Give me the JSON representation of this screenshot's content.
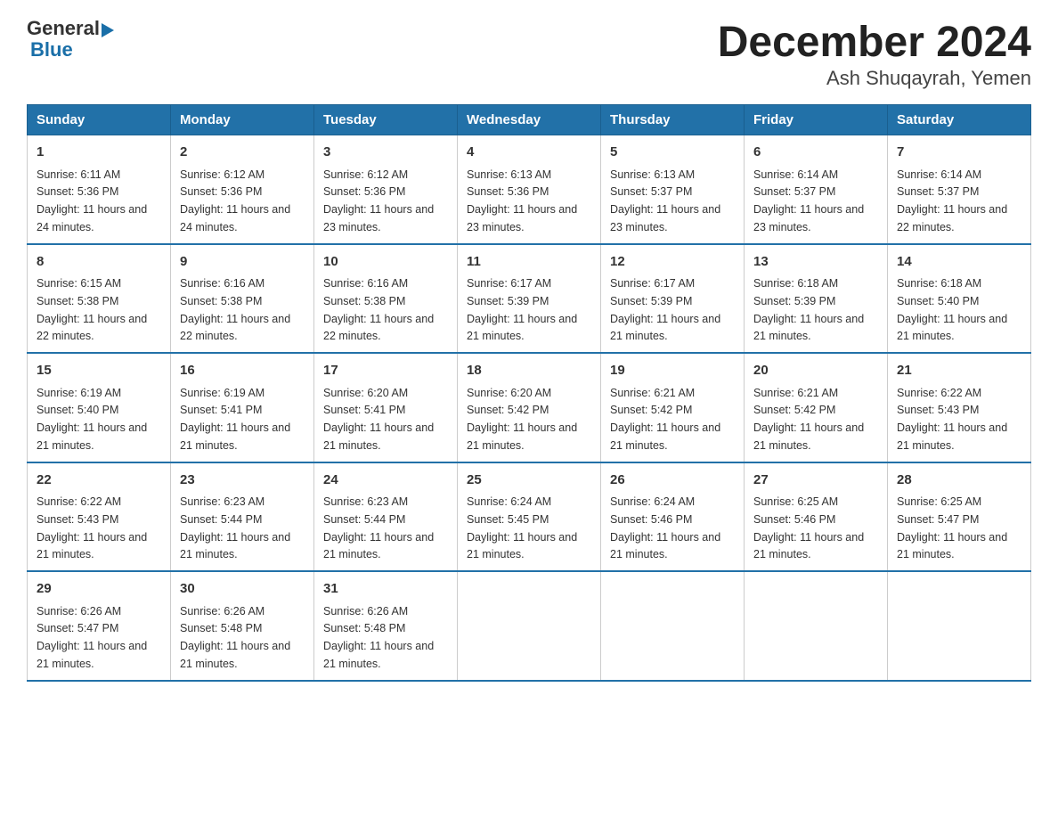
{
  "logo": {
    "general": "General",
    "blue": "Blue"
  },
  "title": "December 2024",
  "subtitle": "Ash Shuqayrah, Yemen",
  "days_of_week": [
    "Sunday",
    "Monday",
    "Tuesday",
    "Wednesday",
    "Thursday",
    "Friday",
    "Saturday"
  ],
  "weeks": [
    [
      {
        "day": "1",
        "sunrise": "6:11 AM",
        "sunset": "5:36 PM",
        "daylight": "11 hours and 24 minutes."
      },
      {
        "day": "2",
        "sunrise": "6:12 AM",
        "sunset": "5:36 PM",
        "daylight": "11 hours and 24 minutes."
      },
      {
        "day": "3",
        "sunrise": "6:12 AM",
        "sunset": "5:36 PM",
        "daylight": "11 hours and 23 minutes."
      },
      {
        "day": "4",
        "sunrise": "6:13 AM",
        "sunset": "5:36 PM",
        "daylight": "11 hours and 23 minutes."
      },
      {
        "day": "5",
        "sunrise": "6:13 AM",
        "sunset": "5:37 PM",
        "daylight": "11 hours and 23 minutes."
      },
      {
        "day": "6",
        "sunrise": "6:14 AM",
        "sunset": "5:37 PM",
        "daylight": "11 hours and 23 minutes."
      },
      {
        "day": "7",
        "sunrise": "6:14 AM",
        "sunset": "5:37 PM",
        "daylight": "11 hours and 22 minutes."
      }
    ],
    [
      {
        "day": "8",
        "sunrise": "6:15 AM",
        "sunset": "5:38 PM",
        "daylight": "11 hours and 22 minutes."
      },
      {
        "day": "9",
        "sunrise": "6:16 AM",
        "sunset": "5:38 PM",
        "daylight": "11 hours and 22 minutes."
      },
      {
        "day": "10",
        "sunrise": "6:16 AM",
        "sunset": "5:38 PM",
        "daylight": "11 hours and 22 minutes."
      },
      {
        "day": "11",
        "sunrise": "6:17 AM",
        "sunset": "5:39 PM",
        "daylight": "11 hours and 21 minutes."
      },
      {
        "day": "12",
        "sunrise": "6:17 AM",
        "sunset": "5:39 PM",
        "daylight": "11 hours and 21 minutes."
      },
      {
        "day": "13",
        "sunrise": "6:18 AM",
        "sunset": "5:39 PM",
        "daylight": "11 hours and 21 minutes."
      },
      {
        "day": "14",
        "sunrise": "6:18 AM",
        "sunset": "5:40 PM",
        "daylight": "11 hours and 21 minutes."
      }
    ],
    [
      {
        "day": "15",
        "sunrise": "6:19 AM",
        "sunset": "5:40 PM",
        "daylight": "11 hours and 21 minutes."
      },
      {
        "day": "16",
        "sunrise": "6:19 AM",
        "sunset": "5:41 PM",
        "daylight": "11 hours and 21 minutes."
      },
      {
        "day": "17",
        "sunrise": "6:20 AM",
        "sunset": "5:41 PM",
        "daylight": "11 hours and 21 minutes."
      },
      {
        "day": "18",
        "sunrise": "6:20 AM",
        "sunset": "5:42 PM",
        "daylight": "11 hours and 21 minutes."
      },
      {
        "day": "19",
        "sunrise": "6:21 AM",
        "sunset": "5:42 PM",
        "daylight": "11 hours and 21 minutes."
      },
      {
        "day": "20",
        "sunrise": "6:21 AM",
        "sunset": "5:42 PM",
        "daylight": "11 hours and 21 minutes."
      },
      {
        "day": "21",
        "sunrise": "6:22 AM",
        "sunset": "5:43 PM",
        "daylight": "11 hours and 21 minutes."
      }
    ],
    [
      {
        "day": "22",
        "sunrise": "6:22 AM",
        "sunset": "5:43 PM",
        "daylight": "11 hours and 21 minutes."
      },
      {
        "day": "23",
        "sunrise": "6:23 AM",
        "sunset": "5:44 PM",
        "daylight": "11 hours and 21 minutes."
      },
      {
        "day": "24",
        "sunrise": "6:23 AM",
        "sunset": "5:44 PM",
        "daylight": "11 hours and 21 minutes."
      },
      {
        "day": "25",
        "sunrise": "6:24 AM",
        "sunset": "5:45 PM",
        "daylight": "11 hours and 21 minutes."
      },
      {
        "day": "26",
        "sunrise": "6:24 AM",
        "sunset": "5:46 PM",
        "daylight": "11 hours and 21 minutes."
      },
      {
        "day": "27",
        "sunrise": "6:25 AM",
        "sunset": "5:46 PM",
        "daylight": "11 hours and 21 minutes."
      },
      {
        "day": "28",
        "sunrise": "6:25 AM",
        "sunset": "5:47 PM",
        "daylight": "11 hours and 21 minutes."
      }
    ],
    [
      {
        "day": "29",
        "sunrise": "6:26 AM",
        "sunset": "5:47 PM",
        "daylight": "11 hours and 21 minutes."
      },
      {
        "day": "30",
        "sunrise": "6:26 AM",
        "sunset": "5:48 PM",
        "daylight": "11 hours and 21 minutes."
      },
      {
        "day": "31",
        "sunrise": "6:26 AM",
        "sunset": "5:48 PM",
        "daylight": "11 hours and 21 minutes."
      },
      null,
      null,
      null,
      null
    ]
  ]
}
